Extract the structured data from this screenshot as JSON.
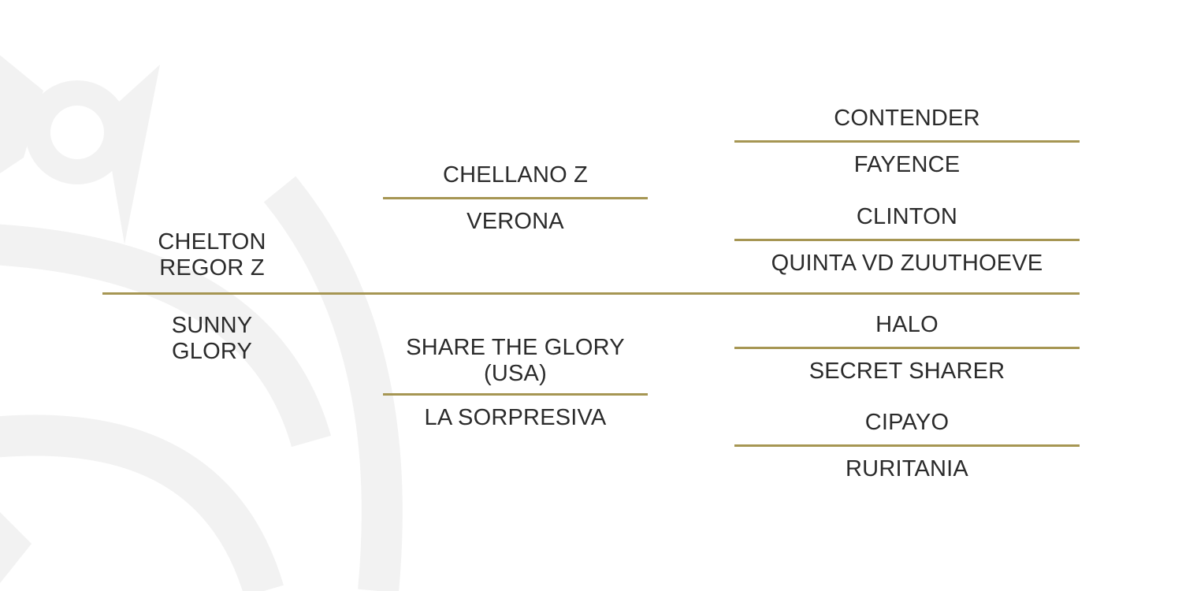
{
  "colors": {
    "background": "#ffffff",
    "divider_gold": "#a69653",
    "text": "#2b2b2b",
    "watermark": "#f2f2f2"
  },
  "watermark": {
    "icon": "crown-logo-watermark"
  },
  "pedigree": {
    "sire": {
      "name_line1": "CHELTON",
      "name_line2": "REGOR Z",
      "sire": {
        "name": "CHELLANO Z",
        "sire": "CONTENDER",
        "dam": "FAYENCE"
      },
      "dam": {
        "name": "VERONA",
        "sire": "CLINTON",
        "dam": "QUINTA VD ZUUTHOEVE"
      }
    },
    "dam": {
      "name_line1": "SUNNY",
      "name_line2": "GLORY",
      "sire": {
        "name_line1": "SHARE THE GLORY",
        "name_line2": "(USA)",
        "sire": "HALO",
        "dam": "SECRET SHARER"
      },
      "dam": {
        "name": "LA SORPRESIVA",
        "sire": "CIPAYO",
        "dam": "RURITANIA"
      }
    }
  }
}
